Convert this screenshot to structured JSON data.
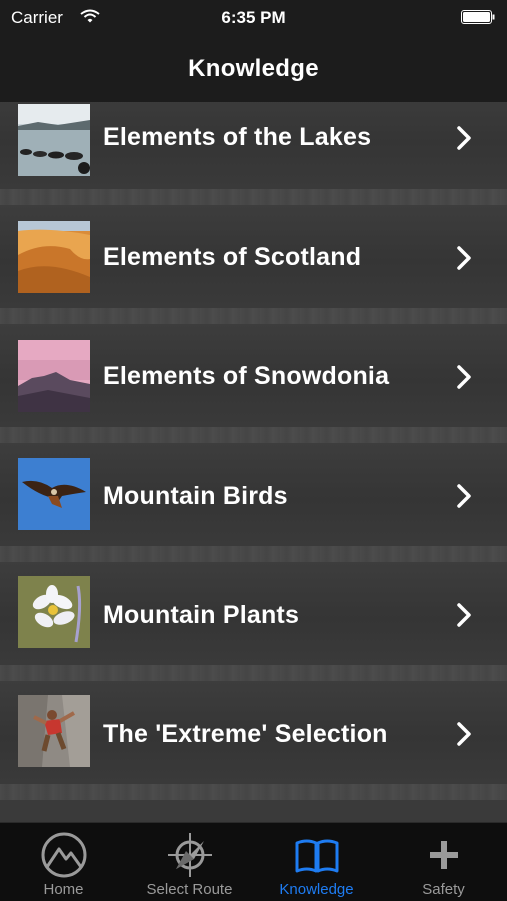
{
  "status_bar": {
    "carrier": "Carrier",
    "time": "6:35 PM"
  },
  "nav": {
    "title": "Knowledge"
  },
  "list": {
    "items": [
      {
        "label": "Elements of the Lakes",
        "thumb": "lake-photo"
      },
      {
        "label": "Elements of Scotland",
        "thumb": "sand-dune-photo"
      },
      {
        "label": "Elements of Snowdonia",
        "thumb": "mountain-dusk-photo"
      },
      {
        "label": "Mountain Birds",
        "thumb": "kite-bird-photo"
      },
      {
        "label": "Mountain Plants",
        "thumb": "white-flower-photo"
      },
      {
        "label": "The 'Extreme' Selection",
        "thumb": "rock-climber-photo"
      }
    ]
  },
  "tab_bar": {
    "tabs": [
      {
        "label": "Home",
        "icon": "mountain-circle-icon",
        "active": false
      },
      {
        "label": "Select Route",
        "icon": "compass-icon",
        "active": false
      },
      {
        "label": "Knowledge",
        "icon": "book-icon",
        "active": true
      },
      {
        "label": "Safety",
        "icon": "plus-icon",
        "active": false
      }
    ]
  },
  "colors": {
    "active_tab": "#1e7cf2",
    "inactive_tab": "#9a9a9a"
  }
}
